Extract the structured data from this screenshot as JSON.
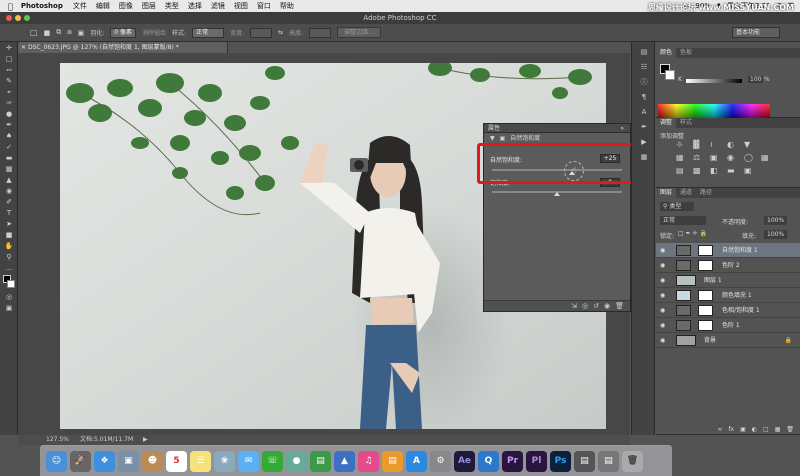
{
  "menubar": {
    "app": "Photoshop",
    "items": [
      "文件",
      "编辑",
      "图像",
      "图层",
      "类型",
      "选择",
      "滤镜",
      "视图",
      "窗口",
      "帮助"
    ],
    "battery": "90%",
    "clock": "周六下午2:21"
  },
  "watermark": "思缘设计论坛 www.MISSYUAN.COM",
  "window_title": "Adobe Photoshop CC",
  "options_bar": {
    "feather_label": "羽化:",
    "feather_value": "0 像素",
    "antialias": "消除锯齿",
    "style_label": "样式:",
    "style_value": "正常",
    "width_label": "宽度:",
    "height_label": "高度:",
    "refine_edge": "调整边缘...",
    "workspace": "基本功能"
  },
  "document_tab": "DSC_0623.JPG @ 127% (自然饱和度 1, 图层蒙版/8) *",
  "status": {
    "zoom": "127.5%",
    "doc": "文档:5.01M/11.7M"
  },
  "properties": {
    "title": "属性",
    "subtitle": "自然饱和度",
    "vibrance_label": "自然饱和度:",
    "vibrance_value": "+25",
    "saturation_label": "饱和度:",
    "saturation_value": "0"
  },
  "color_panel": {
    "tabs": [
      "颜色",
      "色板"
    ],
    "k_label": "K",
    "k_value": "100",
    "k_unit": "%"
  },
  "adjust_panel": {
    "tabs": [
      "调整",
      "样式"
    ],
    "title": "添加调整"
  },
  "layers_panel": {
    "tabs": [
      "图层",
      "通道",
      "路径"
    ],
    "kind_label": "类型",
    "blend_mode": "正常",
    "opacity_label": "不透明度:",
    "opacity_value": "100%",
    "lock_label": "锁定:",
    "fill_label": "填充:",
    "fill_value": "100%",
    "layers": [
      {
        "name": "自然饱和度 1",
        "selected": true
      },
      {
        "name": "色阶 2",
        "selected": false
      },
      {
        "name": "图层 1",
        "selected": false
      },
      {
        "name": "颜色填充 1",
        "selected": false
      },
      {
        "name": "色相/饱和度 1",
        "selected": false
      },
      {
        "name": "色阶 1",
        "selected": false
      },
      {
        "name": "背景",
        "selected": false
      }
    ]
  },
  "dock": {
    "calendar_day": "5"
  },
  "colors": {
    "highlight": "#e0191f",
    "selected_layer": "#6d7580",
    "ps_blue": "#2fa3f3",
    "ae_purple": "#9b8bd8"
  }
}
